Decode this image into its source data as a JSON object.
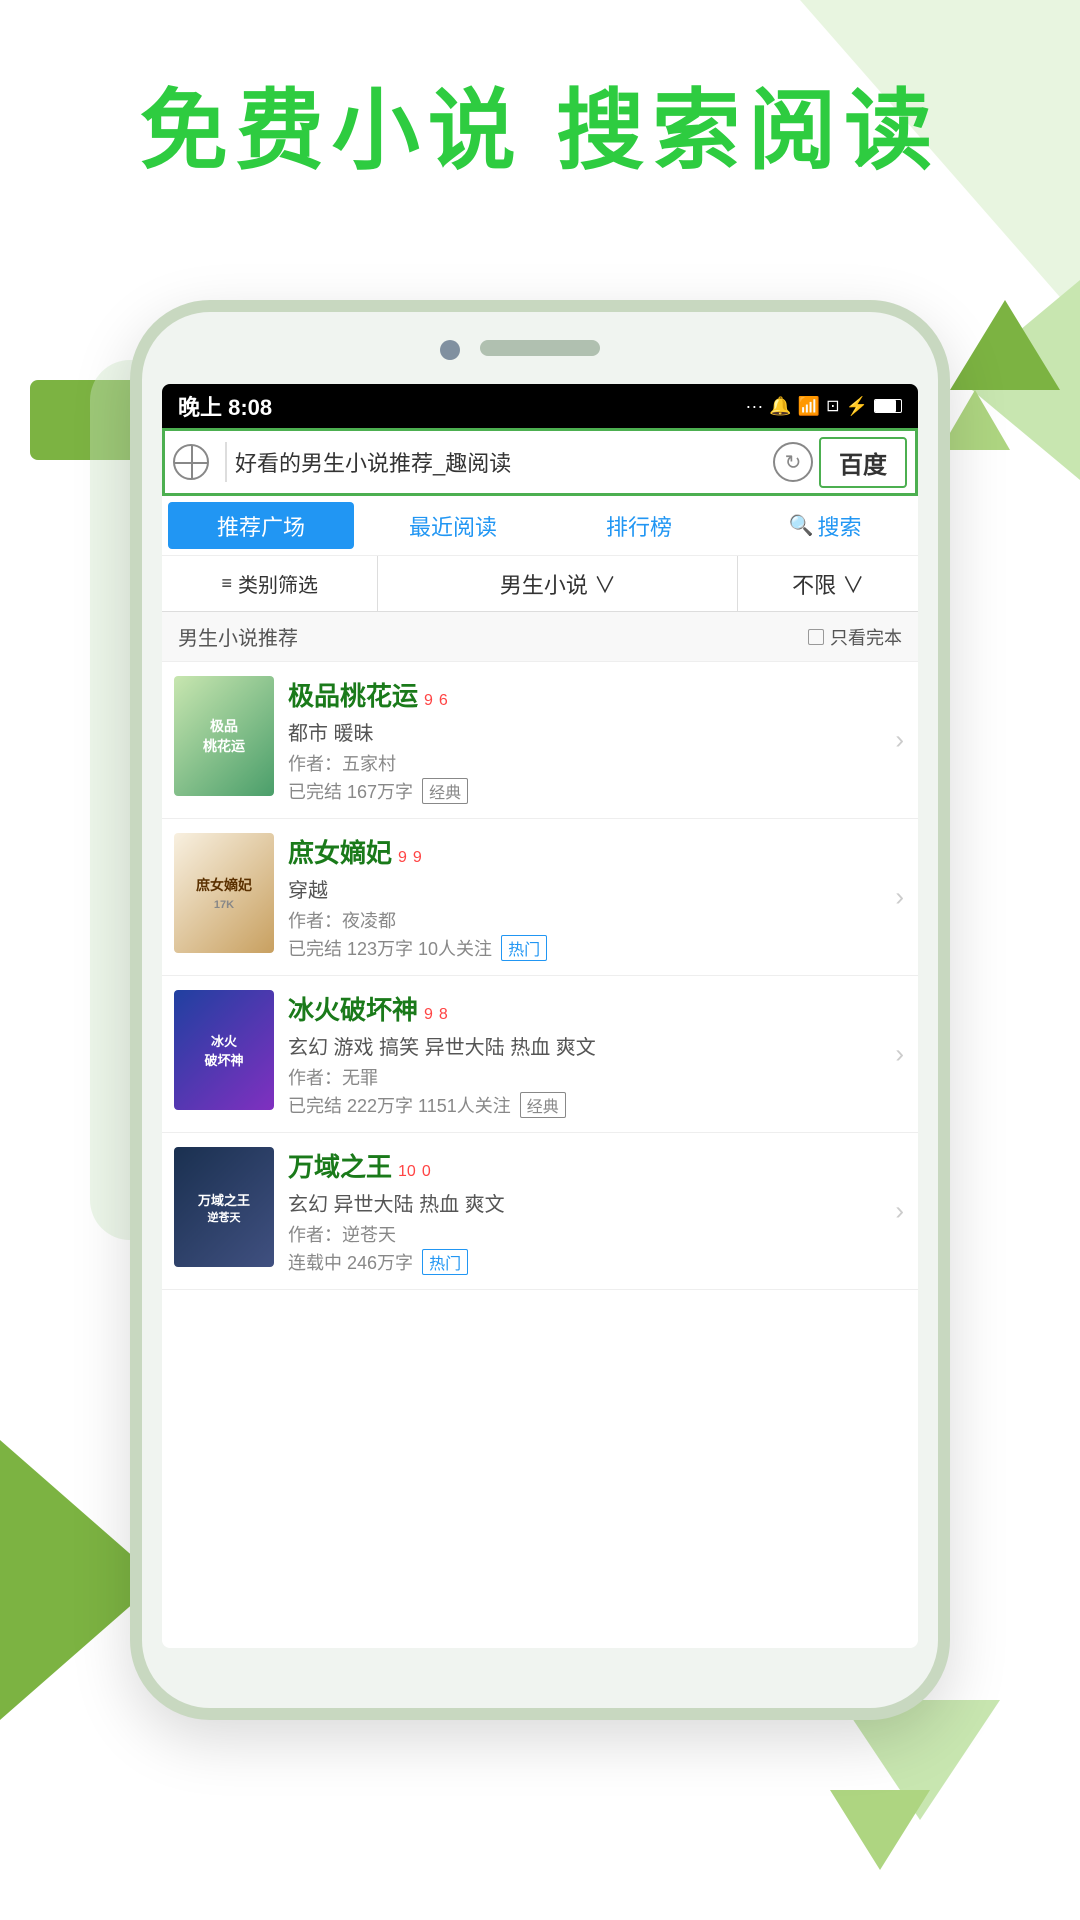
{
  "page": {
    "background_color": "#ffffff"
  },
  "header": {
    "title": "免费小说  搜索阅读"
  },
  "status_bar": {
    "time": "晚上 8:08",
    "icons": "... 🔔 📶 ☐ ⚡ 🔋"
  },
  "search_bar": {
    "query": "好看的男生小说推荐_趣阅读",
    "baidu_label": "百度"
  },
  "nav_tabs": [
    {
      "id": "recommend",
      "label": "推荐广场",
      "active": true
    },
    {
      "id": "recent",
      "label": "最近阅读",
      "active": false
    },
    {
      "id": "ranking",
      "label": "排行榜",
      "active": false
    },
    {
      "id": "search",
      "label": "搜索",
      "active": false,
      "has_icon": true
    }
  ],
  "filter_bar": {
    "category_label": "类别筛选",
    "type_label": "男生小说 ∨",
    "limit_label": "不限 ∨"
  },
  "section": {
    "title": "男生小说推荐",
    "filter_label": "只看完本"
  },
  "books": [
    {
      "id": 1,
      "title": "极品桃花运",
      "rating_main": "9",
      "rating_sup": "6",
      "tags": "都市 暖昧",
      "author": "作者：五家村",
      "meta": "已完结 167万字",
      "badge": "经典",
      "badge_type": "normal",
      "cover_text": "极品\n桃花运"
    },
    {
      "id": 2,
      "title": "庶女嫡妃",
      "rating_main": "9",
      "rating_sup": "9",
      "tags": "穿越",
      "author": "作者：夜凌都",
      "meta": "已完结 123万字 10人关注",
      "badge": "热门",
      "badge_type": "hot",
      "cover_text": "庶女嫡妃"
    },
    {
      "id": 3,
      "title": "冰火破坏神",
      "rating_main": "9",
      "rating_sup": "8",
      "tags": "玄幻 游戏 搞笑 异世大陆 热血 爽文",
      "author": "作者：无罪",
      "meta": "已完结 222万字 1151人关注",
      "badge": "经典",
      "badge_type": "normal",
      "cover_text": "冰火\n破坏神"
    },
    {
      "id": 4,
      "title": "万域之王",
      "rating_main": "10",
      "rating_sup": "0",
      "tags": "玄幻 异世大陆 热血 爽文",
      "author": "作者：逆苍天",
      "meta": "连载中 246万字",
      "badge": "热门",
      "badge_type": "hot",
      "cover_text": "万域之王"
    }
  ]
}
